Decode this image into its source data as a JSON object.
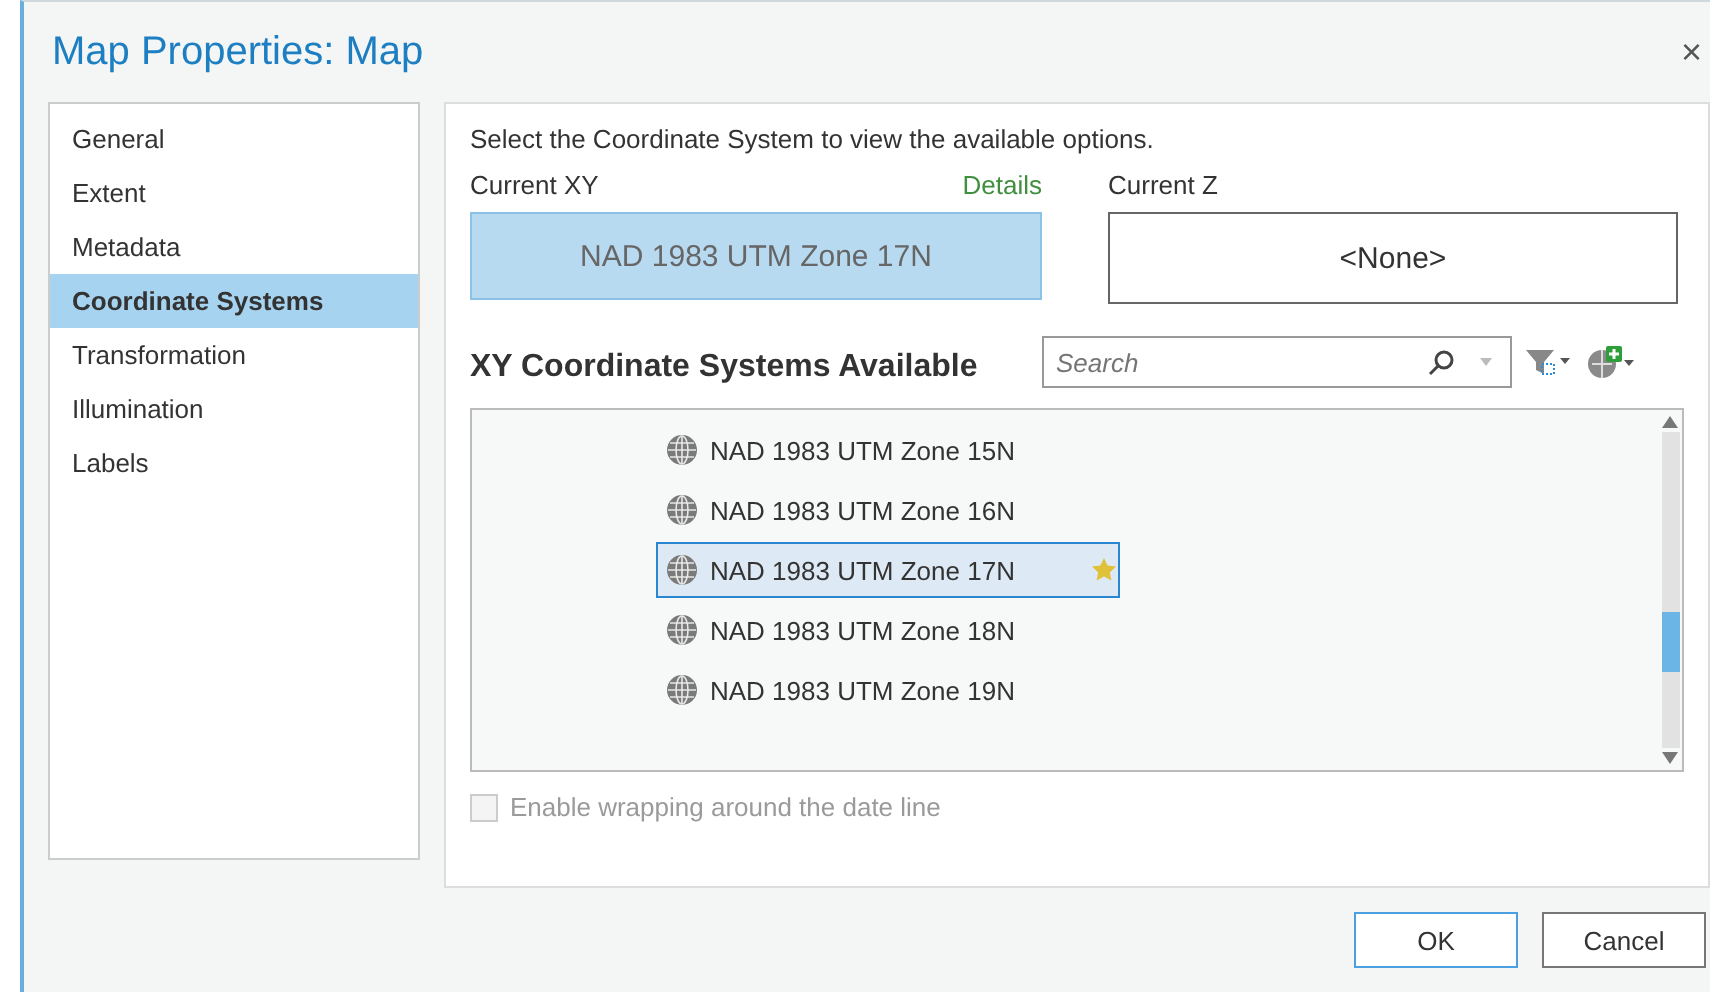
{
  "window": {
    "title": "Map Properties: Map",
    "close": "×"
  },
  "sidebar": {
    "items": [
      {
        "label": "General",
        "selected": false
      },
      {
        "label": "Extent",
        "selected": false
      },
      {
        "label": "Metadata",
        "selected": false
      },
      {
        "label": "Coordinate Systems",
        "selected": true
      },
      {
        "label": "Transformation",
        "selected": false
      },
      {
        "label": "Illumination",
        "selected": false
      },
      {
        "label": "Labels",
        "selected": false
      }
    ]
  },
  "panel": {
    "instruction": "Select the Coordinate System to view the available options.",
    "current_xy": {
      "label": "Current XY",
      "link": "Details",
      "value": "NAD 1983 UTM Zone 17N"
    },
    "current_z": {
      "label": "Current Z",
      "value": "<None>"
    },
    "available": {
      "heading": "XY Coordinate Systems Available",
      "search": {
        "placeholder": "Search"
      },
      "rows": [
        {
          "label": "NAD 1983 UTM Zone 15N",
          "selected": false,
          "favorite": false
        },
        {
          "label": "NAD 1983 UTM Zone 16N",
          "selected": false,
          "favorite": false
        },
        {
          "label": "NAD 1983 UTM Zone 17N",
          "selected": true,
          "favorite": true
        },
        {
          "label": "NAD 1983 UTM Zone 18N",
          "selected": false,
          "favorite": false
        },
        {
          "label": "NAD 1983 UTM Zone 19N",
          "selected": false,
          "favorite": false
        }
      ]
    },
    "wrap_option": {
      "label": "Enable wrapping around the date line",
      "checked": false,
      "disabled": true
    }
  },
  "buttons": [
    {
      "label": "OK",
      "kind": "primary"
    },
    {
      "label": "Cancel",
      "kind": "secondary"
    }
  ]
}
